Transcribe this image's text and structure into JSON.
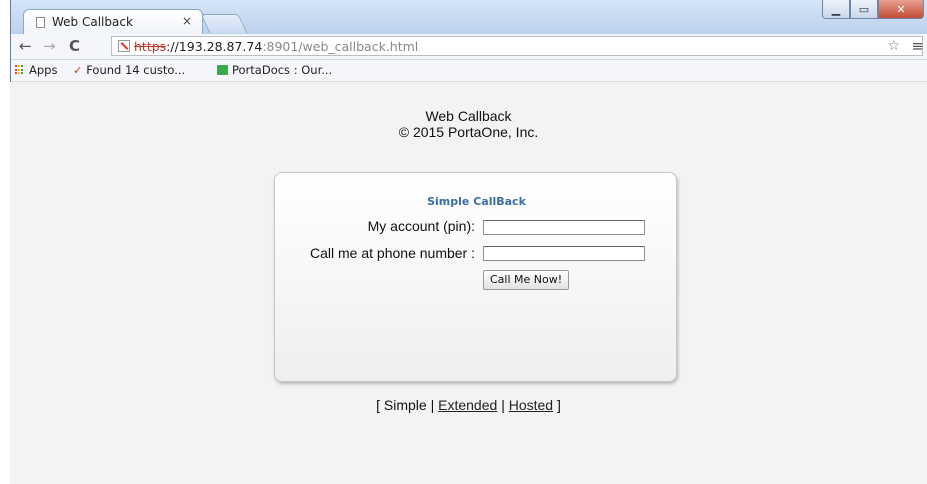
{
  "browser": {
    "tab_title": "Web Callback",
    "tab_close": "×",
    "url_scheme": "https",
    "url_host": "://193.28.87.74",
    "url_rest": ":8901/web_callback.html",
    "bookmarks": [
      {
        "label": "Apps"
      },
      {
        "label": "Found 14 custo..."
      },
      {
        "label": "PortaDocs : Our..."
      }
    ]
  },
  "page": {
    "title": "Web Callback",
    "copyright": "© 2015 PortaOne, Inc.",
    "form": {
      "heading": "Simple CallBack",
      "account_label": "My account (pin):",
      "account_value": "",
      "phone_label": "Call me at phone number :",
      "phone_value": "",
      "submit_label": "Call Me Now!"
    },
    "modes": {
      "open": "[",
      "simple": "Simple",
      "sep": "|",
      "extended": "Extended",
      "hosted": "Hosted",
      "close": "]"
    }
  },
  "colors": {
    "accent": "#3a6ea5",
    "page_bg": "#f3f3f3"
  }
}
